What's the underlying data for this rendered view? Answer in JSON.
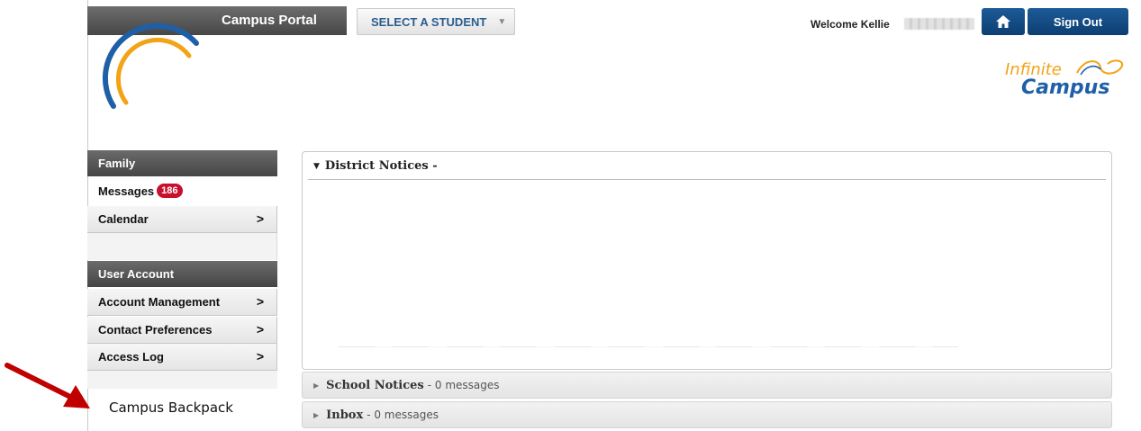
{
  "header": {
    "portal_title": "Campus Portal",
    "select_student": "SELECT A STUDENT",
    "welcome": "Welcome Kellie",
    "sign_out": "Sign Out",
    "brand_line1": "Infinite",
    "brand_line2": "Campus"
  },
  "sidebar": {
    "family_heading": "Family",
    "messages_label": "Messages",
    "messages_badge": "186",
    "calendar_label": "Calendar",
    "user_account_heading": "User Account",
    "account_management": "Account Management",
    "contact_preferences": "Contact Preferences",
    "access_log": "Access Log",
    "chevron": ">",
    "backpack_label": "Campus Backpack"
  },
  "main": {
    "district_notices": "District Notices",
    "district_suffix": " -",
    "school_notices": "School Notices",
    "school_count": "- 0 messages",
    "inbox": "Inbox",
    "inbox_count": "- 0 messages"
  },
  "colors": {
    "accent_blue": "#1d5a97",
    "badge_red": "#c8102e",
    "arrow_red": "#c00000"
  }
}
